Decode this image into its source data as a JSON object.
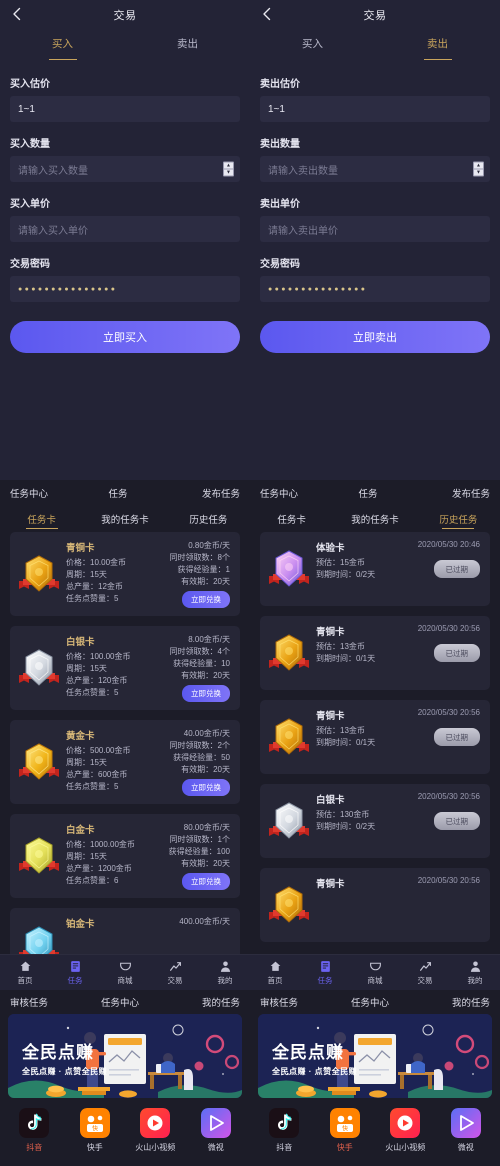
{
  "theme": {
    "bg": "#1c1c28",
    "panel_bg": "#232336",
    "card_bg": "#262636",
    "accent_gold": "#c8a45c",
    "accent_purple": "#6b63f2",
    "text_primary": "#e8e8f2",
    "text_muted": "#b6b6c8",
    "active_app": "#e0604c"
  },
  "trade": {
    "left": {
      "title": "交易",
      "back_icon": "chevron-left-icon",
      "tabs": [
        {
          "label": "买入",
          "active": true
        },
        {
          "label": "卖出",
          "active": false
        }
      ],
      "fields": [
        {
          "label": "买入估价",
          "value": "1~1",
          "placeholder": "",
          "type": "value"
        },
        {
          "label": "买入数量",
          "value": "",
          "placeholder": "请输入买入数量",
          "type": "number"
        },
        {
          "label": "买入单价",
          "value": "",
          "placeholder": "请输入买入单价",
          "type": "text"
        },
        {
          "label": "交易密码",
          "value": "●●●●●●●●●●●●●●●",
          "placeholder": "",
          "type": "password"
        }
      ],
      "submit_label": "立即买入"
    },
    "right": {
      "title": "交易",
      "back_icon": "chevron-left-icon",
      "tabs": [
        {
          "label": "买入",
          "active": false
        },
        {
          "label": "卖出",
          "active": true
        }
      ],
      "fields": [
        {
          "label": "卖出估价",
          "value": "1~1",
          "placeholder": "",
          "type": "value"
        },
        {
          "label": "卖出数量",
          "value": "",
          "placeholder": "请输入卖出数量",
          "type": "number"
        },
        {
          "label": "卖出单价",
          "value": "",
          "placeholder": "请输入卖出单价",
          "type": "text"
        },
        {
          "label": "交易密码",
          "value": "●●●●●●●●●●●●●●●",
          "placeholder": "",
          "type": "password"
        }
      ],
      "submit_label": "立即卖出"
    }
  },
  "task": {
    "left": {
      "header": [
        "任务中心",
        "任务",
        "发布任务"
      ],
      "tabs": [
        {
          "label": "任务卡",
          "active": true
        },
        {
          "label": "我的任务卡",
          "active": false
        },
        {
          "label": "历史任务",
          "active": false
        }
      ],
      "cards": [
        {
          "name": "青铜卡",
          "badge": "bronze-shield-icon",
          "left_lines": [
            "价格：10.00金币",
            "周期：15天",
            "总产量：12金币",
            "任务点赞量：5"
          ],
          "right_lines": [
            "0.80金币/天",
            "同时领取数：8个",
            "获得经验量：1",
            "有效期：20天"
          ],
          "button": "立即兑换"
        },
        {
          "name": "白银卡",
          "badge": "silver-shield-icon",
          "left_lines": [
            "价格：100.00金币",
            "周期：15天",
            "总产量：120金币",
            "任务点赞量：5"
          ],
          "right_lines": [
            "8.00金币/天",
            "同时领取数：4个",
            "获得经验量：10",
            "有效期：20天"
          ],
          "button": "立即兑换"
        },
        {
          "name": "黄金卡",
          "badge": "gold-shield-icon",
          "left_lines": [
            "价格：500.00金币",
            "周期：15天",
            "总产量：600金币",
            "任务点赞量：5"
          ],
          "right_lines": [
            "40.00金币/天",
            "同时领取数：2个",
            "获得经验量：50",
            "有效期：20天"
          ],
          "button": "立即兑换"
        },
        {
          "name": "白金卡",
          "badge": "platinum-shield-icon",
          "left_lines": [
            "价格：1000.00金币",
            "周期：15天",
            "总产量：1200金币",
            "任务点赞量：6"
          ],
          "right_lines": [
            "80.00金币/天",
            "同时领取数：1个",
            "获得经验量：100",
            "有效期：20天"
          ],
          "button": "立即兑换"
        },
        {
          "name": "铂金卡",
          "badge": "diamond-shield-icon",
          "left_lines": [],
          "right_lines": [
            "400.00金币/天"
          ],
          "button": ""
        }
      ]
    },
    "right": {
      "header": [
        "任务中心",
        "任务",
        "发布任务"
      ],
      "tabs": [
        {
          "label": "任务卡",
          "active": false
        },
        {
          "label": "我的任务卡",
          "active": false
        },
        {
          "label": "历史任务",
          "active": true
        }
      ],
      "cards": [
        {
          "name": "体验卡",
          "badge": "experience-shield-icon",
          "date": "2020/05/30 20:46",
          "left_lines": [
            "预估：15金币",
            "到期时间：0/2天"
          ],
          "button": "已过期"
        },
        {
          "name": "青铜卡",
          "badge": "bronze-shield-icon",
          "date": "2020/05/30 20:56",
          "left_lines": [
            "预估：13金币",
            "到期时间：0/1天"
          ],
          "button": "已过期"
        },
        {
          "name": "青铜卡",
          "badge": "bronze-shield-icon",
          "date": "2020/05/30 20:56",
          "left_lines": [
            "预估：13金币",
            "到期时间：0/1天"
          ],
          "button": "已过期"
        },
        {
          "name": "白银卡",
          "badge": "silver-shield-icon",
          "date": "2020/05/30 20:56",
          "left_lines": [
            "预估：130金币",
            "到期时间：0/2天"
          ],
          "button": "已过期"
        },
        {
          "name": "青铜卡",
          "badge": "bronze-shield-icon",
          "date": "2020/05/30 20:56",
          "left_lines": [],
          "button": ""
        }
      ]
    }
  },
  "bottom_nav": {
    "items": [
      {
        "label": "首页",
        "icon": "home-icon",
        "active": false
      },
      {
        "label": "任务",
        "icon": "task-list-icon",
        "active": true
      },
      {
        "label": "商城",
        "icon": "shop-bag-icon",
        "active": false
      },
      {
        "label": "交易",
        "icon": "chart-trend-icon",
        "active": false
      },
      {
        "label": "我的",
        "icon": "user-person-icon",
        "active": false
      }
    ]
  },
  "video": {
    "left": {
      "header": [
        "审核任务",
        "任务中心",
        "我的任务"
      ],
      "banner": {
        "title": "全民点赚",
        "subtitle": "全民点赚 · 点赞全民赚"
      },
      "apps": [
        {
          "label": "抖音",
          "icon": "douyin-icon",
          "active": true
        },
        {
          "label": "快手",
          "icon": "kuaishou-icon",
          "active": false
        },
        {
          "label": "火山小视频",
          "icon": "huoshan-icon",
          "active": false
        },
        {
          "label": "微视",
          "icon": "weishi-icon",
          "active": false
        }
      ]
    },
    "right": {
      "header": [
        "审核任务",
        "任务中心",
        "我的任务"
      ],
      "banner": {
        "title": "全民点赚",
        "subtitle": "全民点赚 · 点赞全民赚"
      },
      "apps": [
        {
          "label": "抖音",
          "icon": "douyin-icon",
          "active": false
        },
        {
          "label": "快手",
          "icon": "kuaishou-icon",
          "active": true
        },
        {
          "label": "火山小视频",
          "icon": "huoshan-icon",
          "active": false
        },
        {
          "label": "微视",
          "icon": "weishi-icon",
          "active": false
        }
      ]
    }
  }
}
